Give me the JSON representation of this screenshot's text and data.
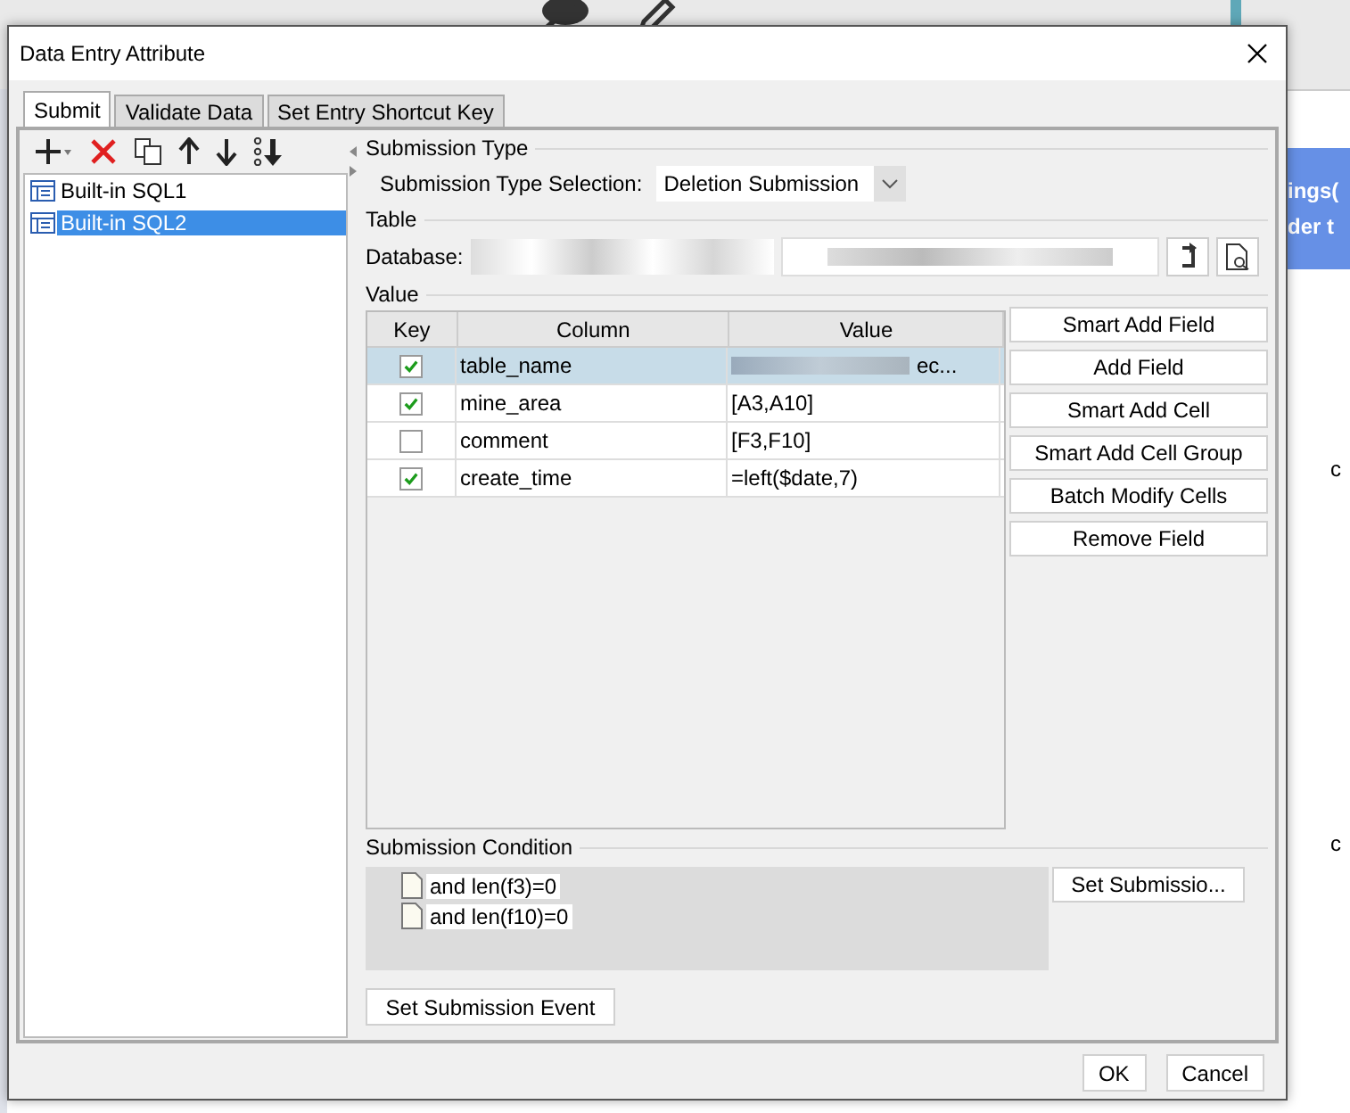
{
  "background": {
    "banner_lines": [
      "ings(",
      "der t"
    ],
    "right_texts": [
      "c",
      "c"
    ]
  },
  "window": {
    "title": "Data Entry Attribute"
  },
  "tabs": [
    {
      "label": "Submit",
      "selected": true
    },
    {
      "label": "Validate Data",
      "selected": false
    },
    {
      "label": "Set Entry Shortcut Key",
      "selected": false
    }
  ],
  "sql_list": [
    {
      "label": "Built-in SQL1",
      "selected": false
    },
    {
      "label": "Built-in SQL2",
      "selected": true
    }
  ],
  "submission_type": {
    "heading": "Submission Type",
    "label": "Submission Type Selection:",
    "value": "Deletion Submission"
  },
  "table_section": {
    "heading": "Table",
    "database_label": "Database:"
  },
  "value_section": {
    "heading": "Value",
    "columns": [
      "Key",
      "Column",
      "Value"
    ],
    "rows": [
      {
        "key": true,
        "column": "table_name",
        "value": "ec...",
        "selected": true
      },
      {
        "key": true,
        "column": "mine_area",
        "value": "[A3,A10]",
        "selected": false
      },
      {
        "key": false,
        "column": "comment",
        "value": "[F3,F10]",
        "selected": false
      },
      {
        "key": true,
        "column": "create_time",
        "value": "=left($date,7)",
        "selected": false
      }
    ],
    "buttons": [
      "Smart Add Field",
      "Add Field",
      "Smart Add Cell",
      "Smart Add Cell Group",
      "Batch Modify Cells",
      "Remove Field"
    ]
  },
  "condition": {
    "heading": "Submission Condition",
    "items": [
      "and len(f3)=0",
      "and len(f10)=0"
    ],
    "button": "Set Submissio..."
  },
  "event_button": "Set Submission Event",
  "footer_buttons": [
    "OK",
    "Cancel"
  ]
}
